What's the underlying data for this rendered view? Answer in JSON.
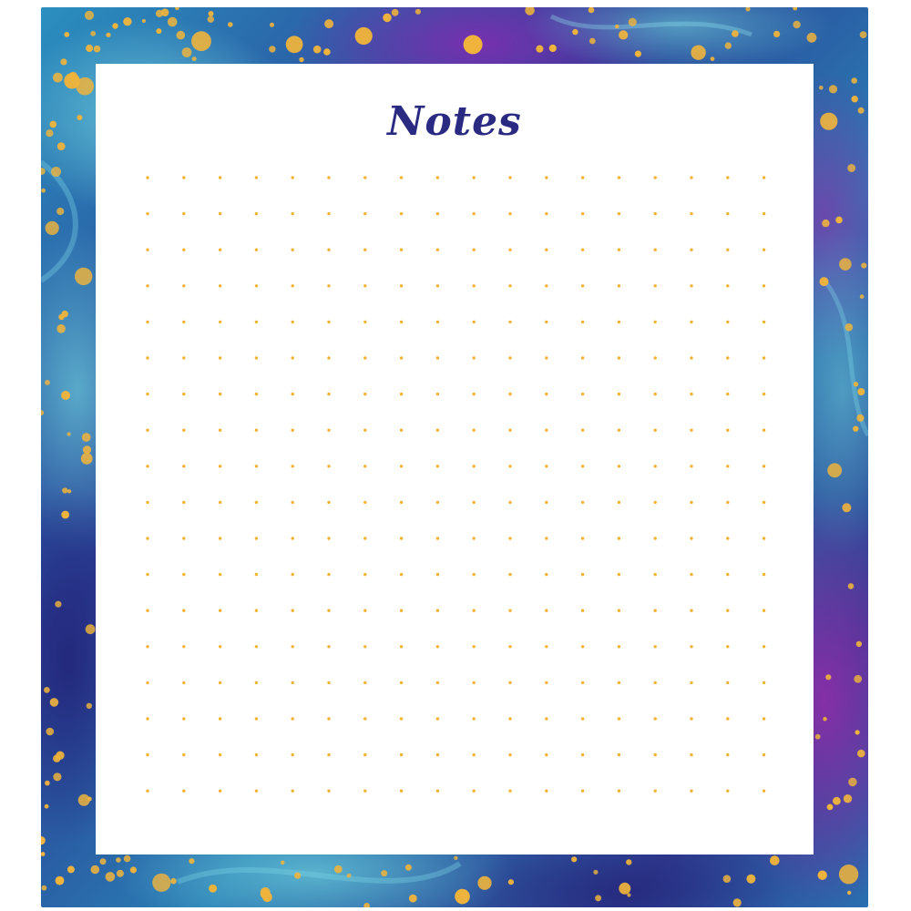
{
  "notepad": {
    "title": "Notes"
  },
  "colors": {
    "title": "#2b2a82",
    "grid_dot": "#f2b233",
    "confetti": "#f0b43c",
    "frame_dark_blue": "#2a2e8a",
    "frame_purple": "#5a2a9a",
    "frame_teal": "#2a9fc0",
    "frame_light_teal": "#63c6d8"
  },
  "grid": {
    "columns": 18,
    "rows": 18
  }
}
